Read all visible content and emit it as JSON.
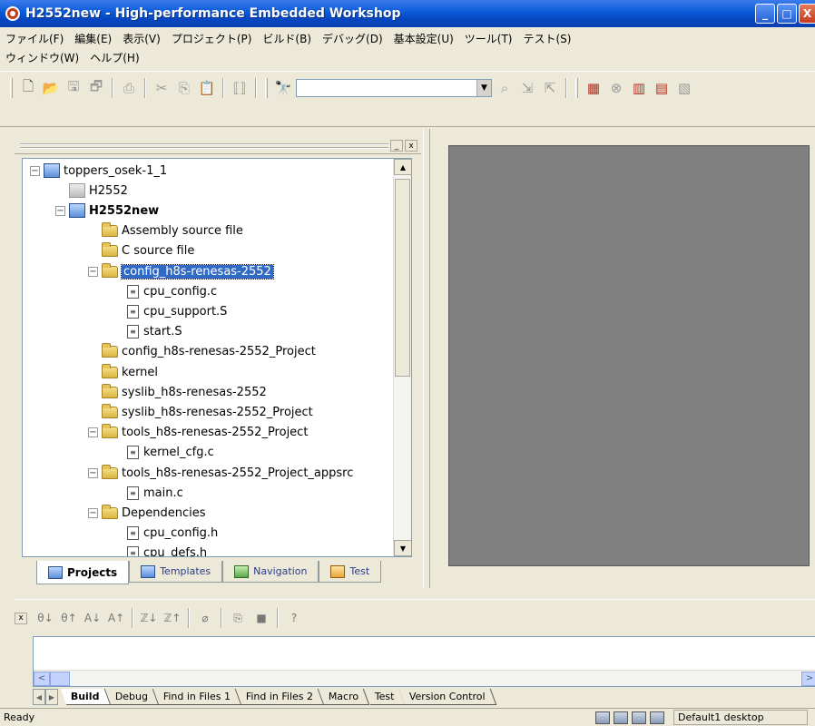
{
  "window": {
    "title": "H2552new - High-performance Embedded Workshop",
    "minimize_glyph": "_",
    "maximize_glyph": "□",
    "close_glyph": "X"
  },
  "menu": {
    "row1": [
      "ファイル(F)",
      "編集(E)",
      "表示(V)",
      "プロジェクト(P)",
      "ビルド(B)",
      "デバッグ(D)",
      "基本設定(U)",
      "ツール(T)",
      "テスト(S)"
    ],
    "row2": [
      "ウィンドウ(W)",
      "ヘルプ(H)"
    ]
  },
  "toolbar": {
    "find_value": "",
    "combo_arrow": "▼"
  },
  "workspace": {
    "panel_min": "_",
    "panel_close": "x",
    "tree": [
      {
        "label": "toppers_osek-1_1",
        "type": "workspace",
        "level": 0,
        "expander": "−",
        "bold": false
      },
      {
        "label": "H2552",
        "type": "project-grey",
        "level": 1,
        "expander": "",
        "bold": false
      },
      {
        "label": "H2552new",
        "type": "project",
        "level": 1,
        "expander": "−",
        "bold": true
      },
      {
        "label": "Assembly source file",
        "type": "folder",
        "level": 2,
        "expander": "",
        "bold": false
      },
      {
        "label": "C source file",
        "type": "folder",
        "level": 2,
        "expander": "",
        "bold": false
      },
      {
        "label": "config_h8s-renesas-2552",
        "type": "folder",
        "level": 2,
        "expander": "−",
        "bold": false,
        "selected": true
      },
      {
        "label": "cpu_config.c",
        "type": "file",
        "level": 3,
        "expander": "",
        "bold": false
      },
      {
        "label": "cpu_support.S",
        "type": "file",
        "level": 3,
        "expander": "",
        "bold": false
      },
      {
        "label": "start.S",
        "type": "file",
        "level": 3,
        "expander": "",
        "bold": false
      },
      {
        "label": "config_h8s-renesas-2552_Project",
        "type": "folder",
        "level": 2,
        "expander": "",
        "bold": false
      },
      {
        "label": "kernel",
        "type": "folder",
        "level": 2,
        "expander": "",
        "bold": false
      },
      {
        "label": "syslib_h8s-renesas-2552",
        "type": "folder",
        "level": 2,
        "expander": "",
        "bold": false
      },
      {
        "label": "syslib_h8s-renesas-2552_Project",
        "type": "folder",
        "level": 2,
        "expander": "",
        "bold": false
      },
      {
        "label": "tools_h8s-renesas-2552_Project",
        "type": "folder",
        "level": 2,
        "expander": "−",
        "bold": false
      },
      {
        "label": "kernel_cfg.c",
        "type": "file",
        "level": 3,
        "expander": "",
        "bold": false
      },
      {
        "label": "tools_h8s-renesas-2552_Project_appsrc",
        "type": "folder",
        "level": 2,
        "expander": "−",
        "bold": false
      },
      {
        "label": "main.c",
        "type": "file",
        "level": 3,
        "expander": "",
        "bold": false
      },
      {
        "label": "Dependencies",
        "type": "folder",
        "level": 2,
        "expander": "−",
        "bold": false
      },
      {
        "label": "cpu_config.h",
        "type": "file",
        "level": 3,
        "expander": "",
        "bold": false
      },
      {
        "label": "cpu_defs.h",
        "type": "file",
        "level": 3,
        "expander": "",
        "bold": false
      }
    ],
    "tabs": [
      {
        "label": "Projects",
        "active": true,
        "icon": "projects-icon"
      },
      {
        "label": "Templates",
        "active": false,
        "icon": "templates-icon"
      },
      {
        "label": "Navigation",
        "active": false,
        "icon": "navigation-icon"
      },
      {
        "label": "Test",
        "active": false,
        "icon": "test-icon"
      }
    ]
  },
  "output": {
    "close_glyph": "x",
    "toolbar_glyphs": [
      "θ↓",
      "θ↑",
      "A↓",
      "A↑",
      "ℤ↓",
      "ℤ↑",
      "⌀",
      "⎘",
      "■",
      "?"
    ],
    "tabs": [
      "Build",
      "Debug",
      "Find in Files 1",
      "Find in Files 2",
      "Macro",
      "Test",
      "Version Control"
    ],
    "active_tab": "Build",
    "scroll_left": "<",
    "scroll_right": ">",
    "nav_left": "◀",
    "nav_right": "▶"
  },
  "status": {
    "text": "Ready",
    "desktop": "Default1 desktop"
  }
}
